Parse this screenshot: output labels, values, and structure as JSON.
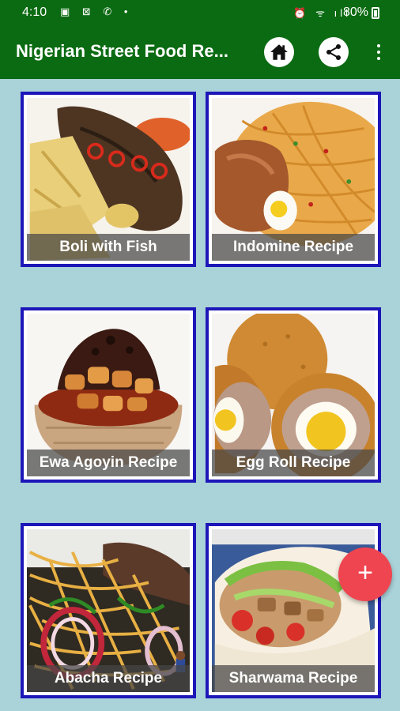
{
  "status_bar": {
    "time": "4:10",
    "left_icons": "▣ ⊠ ✆ •",
    "right_icons": "⏰ ᯤ ıll",
    "battery": "80%"
  },
  "app_bar": {
    "title": "Nigerian Street Food Re...",
    "color": "#0b6b12"
  },
  "recipes": [
    {
      "title": "Boli with Fish"
    },
    {
      "title": "Indomine Recipe"
    },
    {
      "title": "Ewa Agoyin Recipe"
    },
    {
      "title": "Egg Roll Recipe"
    },
    {
      "title": "Abacha Recipe"
    },
    {
      "title": "Sharwama Recipe"
    }
  ],
  "fab": {
    "label": "+",
    "color": "#ef4550"
  },
  "theme": {
    "background": "#a9d2d9",
    "card_border": "#1d16b8"
  }
}
